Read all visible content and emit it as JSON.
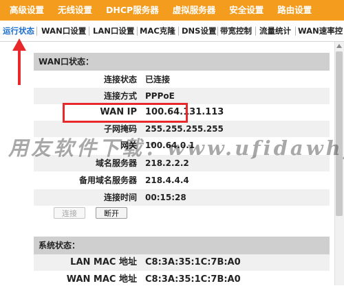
{
  "top_nav": {
    "items": [
      "高级设置",
      "无线设置",
      "DHCP服务器",
      "虚拟服务器",
      "安全设置",
      "路由设置"
    ]
  },
  "sub_nav": {
    "items": [
      "运行状态",
      "WAN口设置",
      "LAN口设置",
      "MAC克隆",
      "DNS设置",
      "带宽控制",
      "流量统计",
      "WAN速率控"
    ],
    "active_index": 0
  },
  "wan_status": {
    "title": "WAN口状态：",
    "rows": [
      {
        "label": "连接状态",
        "value": "已连接"
      },
      {
        "label": "连接方式",
        "value": "PPPoE"
      },
      {
        "label": "WAN IP",
        "value": "100.64.131.113"
      },
      {
        "label": "子网掩码",
        "value": "255.255.255.255"
      },
      {
        "label": "网关",
        "value": "100.64.0.1"
      },
      {
        "label": "域名服务器",
        "value": "218.2.2.2"
      },
      {
        "label": "备用域名服务器",
        "value": "218.4.4.4"
      },
      {
        "label": "连接时间",
        "value": "00:15:28"
      }
    ],
    "connect_label": "连接",
    "disconnect_label": "断开"
  },
  "system_status": {
    "title": "系统状态：",
    "rows": [
      {
        "label": "LAN MAC 地址",
        "value": "C8:3A:35:1C:7B:A0"
      },
      {
        "label": "WAN MAC 地址",
        "value": "C8:3A:35:1C:7B:A0"
      }
    ]
  },
  "annotation": {
    "highlight_color": "#e8282b"
  },
  "watermark": "用友软件下载：www.ufidawhy.com",
  "colors": {
    "nav_orange": "#f39c1e",
    "active_tab": "#1c6fd0",
    "panel_header": "#cfcfcf"
  }
}
